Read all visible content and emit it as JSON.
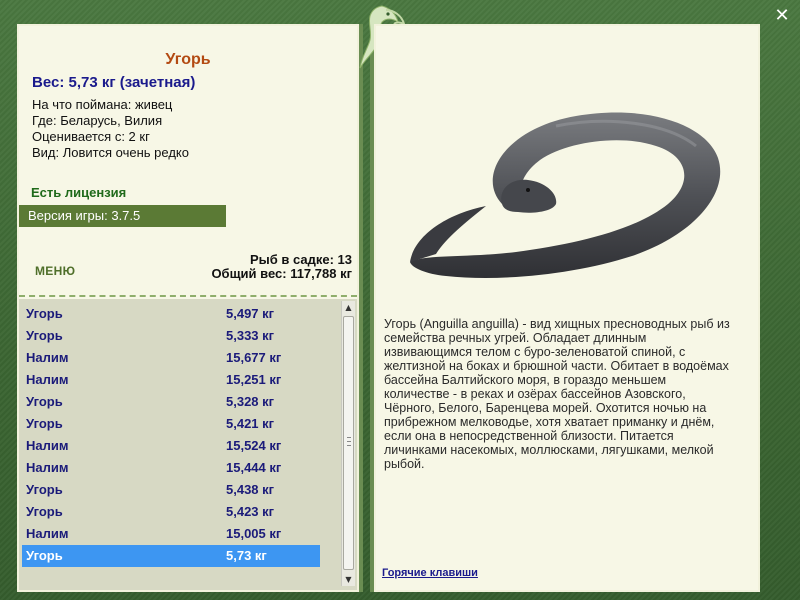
{
  "fish": {
    "name": "Угорь",
    "weight_line": "Вес: 5,73 кг (зачетная)",
    "bait": "На что поймана: живец",
    "location": "Где: Беларусь, Вилия",
    "value": "Оценивается с: 2 кг",
    "kind": "Вид: Ловится очень редко"
  },
  "license": "Есть лицензия",
  "version": "Версия игры: 3.7.5",
  "menu_label": "МЕНЮ",
  "stats": {
    "count": "Рыб в садке: 13",
    "total": "Общий вес: 117,788 кг"
  },
  "catch_list": [
    {
      "name": "Угорь",
      "weight": "5,497 кг"
    },
    {
      "name": "Угорь",
      "weight": "5,333 кг"
    },
    {
      "name": "Налим",
      "weight": "15,677 кг"
    },
    {
      "name": "Налим",
      "weight": "15,251 кг"
    },
    {
      "name": "Угорь",
      "weight": "5,328 кг"
    },
    {
      "name": "Угорь",
      "weight": "5,421 кг"
    },
    {
      "name": "Налим",
      "weight": "15,524 кг"
    },
    {
      "name": "Налим",
      "weight": "15,444 кг"
    },
    {
      "name": "Угорь",
      "weight": "5,438 кг"
    },
    {
      "name": "Угорь",
      "weight": "5,423 кг"
    },
    {
      "name": "Налим",
      "weight": "15,005 кг"
    },
    {
      "name": "Угорь",
      "weight": "5,73 кг"
    }
  ],
  "selected_index": 11,
  "description": "Угорь (Anguilla anguilla) - вид хищных пресноводных рыб из семейства речных угрей. Обладает длинным извивающимся телом с буро-зеленоватой спиной, с желтизной на боках и брюшной части. Обитает в водоёмах бассейна Балтийского моря, в гораздо меньшем количестве - в реках и озёрах бассейнов Азовского, Чёрного, Белого, Баренцева морей. Охотится ночью на прибрежном мелководье, хотя хватает приманку и днём, если она в непосредственной близости. Питается личинками насекомых, моллюсками, лягушками, мелкой рыбой.",
  "hotkeys_label": "Горячие клавиши",
  "icons": {
    "close": "close-icon",
    "logo": "fish-logo-icon",
    "scroll_up": "arrow-up-icon",
    "scroll_down": "arrow-down-icon"
  },
  "colors": {
    "frame": "#3f6a35",
    "panel": "#f7f7e6",
    "title": "#b34a12",
    "list_text": "#1b1b7a",
    "selection": "#3d96f2",
    "version_bar": "#5b7a35"
  }
}
